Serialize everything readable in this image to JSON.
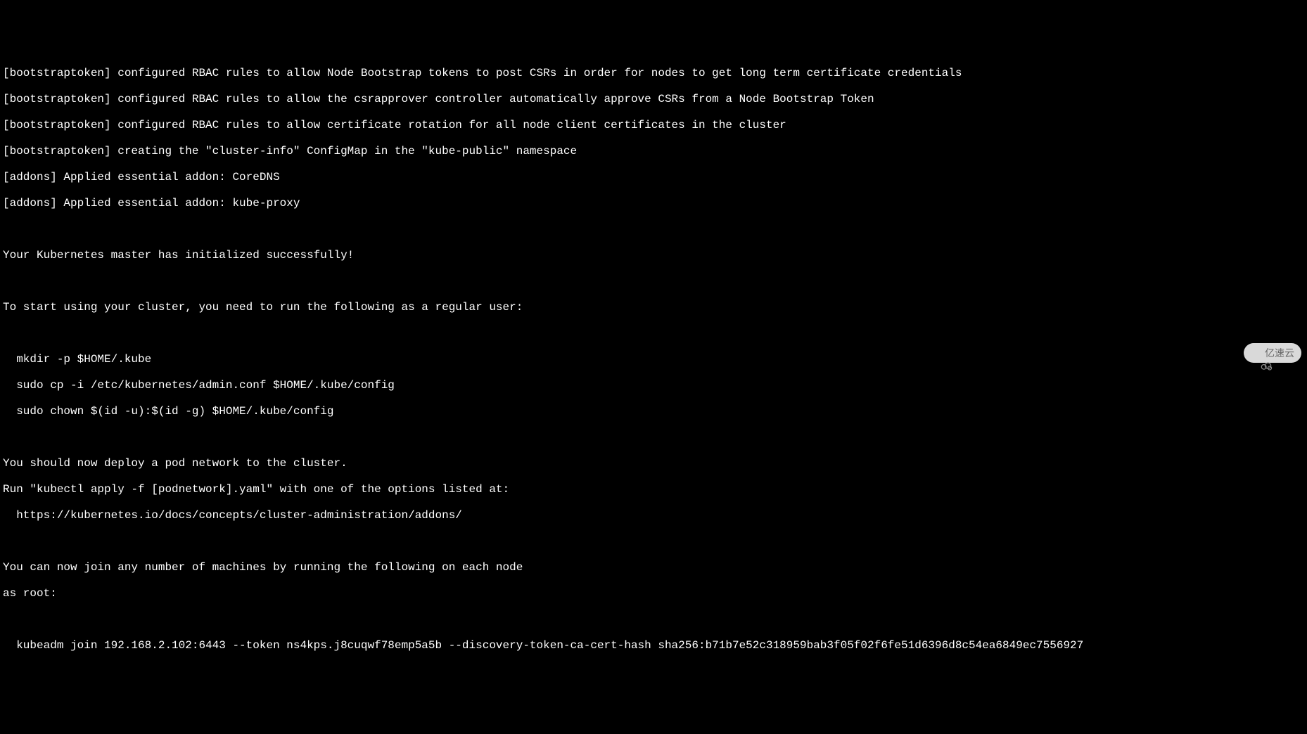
{
  "terminal": {
    "lines": [
      "[bootstraptoken] configured RBAC rules to allow Node Bootstrap tokens to post CSRs in order for nodes to get long term certificate credentials",
      "[bootstraptoken] configured RBAC rules to allow the csrapprover controller automatically approve CSRs from a Node Bootstrap Token",
      "[bootstraptoken] configured RBAC rules to allow certificate rotation for all node client certificates in the cluster",
      "[bootstraptoken] creating the \"cluster-info\" ConfigMap in the \"kube-public\" namespace",
      "[addons] Applied essential addon: CoreDNS",
      "[addons] Applied essential addon: kube-proxy",
      "",
      "Your Kubernetes master has initialized successfully!",
      "",
      "To start using your cluster, you need to run the following as a regular user:",
      "",
      "  mkdir -p $HOME/.kube",
      "  sudo cp -i /etc/kubernetes/admin.conf $HOME/.kube/config",
      "  sudo chown $(id -u):$(id -g) $HOME/.kube/config",
      "",
      "You should now deploy a pod network to the cluster.",
      "Run \"kubectl apply -f [podnetwork].yaml\" with one of the options listed at:",
      "  https://kubernetes.io/docs/concepts/cluster-administration/addons/",
      "",
      "You can now join any number of machines by running the following on each node",
      "as root:",
      "",
      "  kubeadm join 192.168.2.102:6443 --token ns4kps.j8cuqwf78emp5a5b --discovery-token-ca-cert-hash sha256:b71b7e52c318959bab3f05f02f6fe51d6396d8c54ea6849ec7556927"
    ]
  },
  "watermark": {
    "text": "亿速云"
  }
}
